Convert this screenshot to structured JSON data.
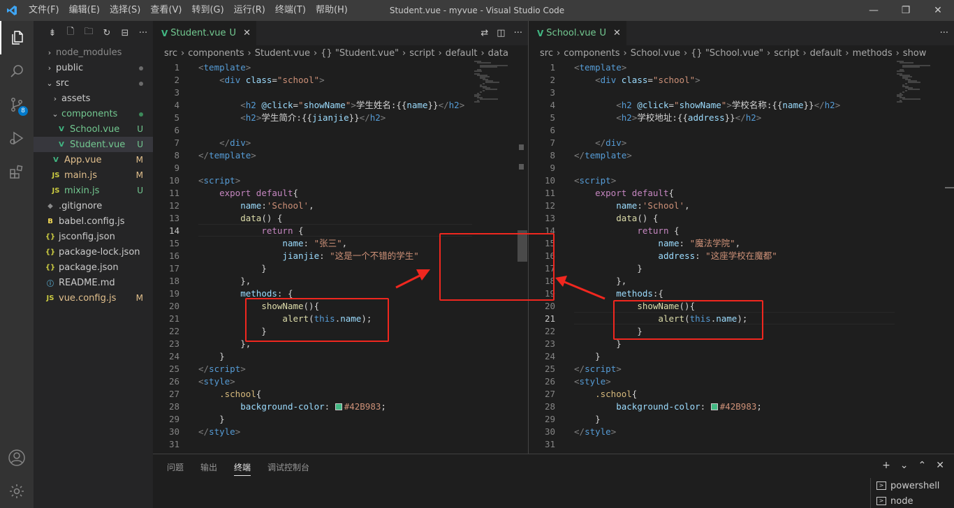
{
  "title": {
    "window_title": "Student.vue - myvue - Visual Studio Code"
  },
  "menu": [
    "文件(F)",
    "编辑(E)",
    "选择(S)",
    "查看(V)",
    "转到(G)",
    "运行(R)",
    "终端(T)",
    "帮助(H)"
  ],
  "window_controls": {
    "minimize": "—",
    "restore": "❐",
    "close": "✕"
  },
  "activity": {
    "scm_badge": "8",
    "icons": [
      "files-icon",
      "search-icon",
      "source-control-icon",
      "run-debug-icon",
      "extensions-icon",
      "account-icon",
      "settings-gear-icon"
    ]
  },
  "sidebar": {
    "toolbar_icons": [
      "collapse-all-icon",
      "new-file-icon",
      "new-folder-icon",
      "refresh-icon",
      "collapse-icon",
      "more-icon"
    ],
    "items": [
      {
        "label": "node_modules",
        "indent": 0,
        "kind": "folder",
        "open": false,
        "color": "#8c8c8c",
        "status": ""
      },
      {
        "label": "public",
        "indent": 0,
        "kind": "folder",
        "open": false,
        "color": "#cccccc",
        "status": "dot"
      },
      {
        "label": "src",
        "indent": 0,
        "kind": "folder",
        "open": true,
        "color": "#cccccc",
        "status": "dot"
      },
      {
        "label": "assets",
        "indent": 1,
        "kind": "folder",
        "open": false,
        "color": "#cccccc",
        "status": ""
      },
      {
        "label": "components",
        "indent": 1,
        "kind": "folder",
        "open": true,
        "color": "#73c991",
        "status": "dot-green"
      },
      {
        "label": "School.vue",
        "indent": 2,
        "kind": "vue",
        "color": "#73c991",
        "status": "U"
      },
      {
        "label": "Student.vue",
        "indent": 2,
        "kind": "vue",
        "color": "#73c991",
        "status": "U",
        "selected": true
      },
      {
        "label": "App.vue",
        "indent": 1,
        "kind": "vue",
        "color": "#e2c08d",
        "status": "M"
      },
      {
        "label": "main.js",
        "indent": 1,
        "kind": "js",
        "color": "#e2c08d",
        "status": "M"
      },
      {
        "label": "mixin.js",
        "indent": 1,
        "kind": "js",
        "color": "#73c991",
        "status": "U"
      },
      {
        "label": ".gitignore",
        "indent": 0,
        "kind": "git",
        "color": "#cccccc",
        "status": ""
      },
      {
        "label": "babel.config.js",
        "indent": 0,
        "kind": "babel",
        "color": "#cccccc",
        "status": ""
      },
      {
        "label": "jsconfig.json",
        "indent": 0,
        "kind": "json",
        "color": "#cccccc",
        "status": ""
      },
      {
        "label": "package-lock.json",
        "indent": 0,
        "kind": "json",
        "color": "#cccccc",
        "status": ""
      },
      {
        "label": "package.json",
        "indent": 0,
        "kind": "json",
        "color": "#cccccc",
        "status": ""
      },
      {
        "label": "README.md",
        "indent": 0,
        "kind": "info",
        "color": "#cccccc",
        "status": ""
      },
      {
        "label": "vue.config.js",
        "indent": 0,
        "kind": "js",
        "color": "#e2c08d",
        "status": "M"
      }
    ]
  },
  "editors": [
    {
      "tab": {
        "name": "Student.vue",
        "status": "U",
        "close": "✕"
      },
      "tab_actions": [
        "⇄",
        "◫",
        "···"
      ],
      "breadcrumbs": [
        "src",
        "components",
        "Student.vue",
        "{} \"Student.vue\"",
        "script",
        "default",
        "data"
      ],
      "current_line": 14,
      "lines": [
        [
          [
            "t-punc",
            "<"
          ],
          [
            "t-tag",
            "template"
          ],
          [
            "t-punc",
            ">"
          ]
        ],
        [
          [
            "t-txt",
            "    "
          ],
          [
            "t-punc",
            "<"
          ],
          [
            "t-tag",
            "div"
          ],
          [
            "t-txt",
            " "
          ],
          [
            "t-attr",
            "class"
          ],
          [
            "t-txt",
            "="
          ],
          [
            "t-str",
            "\"school\""
          ],
          [
            "t-punc",
            ">"
          ]
        ],
        [],
        [
          [
            "t-txt",
            "        "
          ],
          [
            "t-punc",
            "<"
          ],
          [
            "t-tag",
            "h2"
          ],
          [
            "t-txt",
            " "
          ],
          [
            "t-attr",
            "@click"
          ],
          [
            "t-txt",
            "="
          ],
          [
            "t-str",
            "\""
          ],
          [
            "t-attr",
            "showName"
          ],
          [
            "t-str",
            "\""
          ],
          [
            "t-punc",
            ">"
          ],
          [
            "t-txt",
            "学生姓名:{{"
          ],
          [
            "t-prop",
            "name"
          ],
          [
            "t-txt",
            "}}"
          ],
          [
            "t-punc",
            "</"
          ],
          [
            "t-tag",
            "h2"
          ],
          [
            "t-punc",
            ">"
          ]
        ],
        [
          [
            "t-txt",
            "        "
          ],
          [
            "t-punc",
            "<"
          ],
          [
            "t-tag",
            "h2"
          ],
          [
            "t-punc",
            ">"
          ],
          [
            "t-txt",
            "学生简介:{{"
          ],
          [
            "t-prop",
            "jianjie"
          ],
          [
            "t-txt",
            "}}"
          ],
          [
            "t-punc",
            "</"
          ],
          [
            "t-tag",
            "h2"
          ],
          [
            "t-punc",
            ">"
          ]
        ],
        [],
        [
          [
            "t-txt",
            "    "
          ],
          [
            "t-punc",
            "</"
          ],
          [
            "t-tag",
            "div"
          ],
          [
            "t-punc",
            ">"
          ]
        ],
        [
          [
            "t-punc",
            "</"
          ],
          [
            "t-tag",
            "template"
          ],
          [
            "t-punc",
            ">"
          ]
        ],
        [],
        [
          [
            "t-punc",
            "<"
          ],
          [
            "t-tag",
            "script"
          ],
          [
            "t-punc",
            ">"
          ]
        ],
        [
          [
            "t-txt",
            "    "
          ],
          [
            "t-kw2",
            "export"
          ],
          [
            "t-txt",
            " "
          ],
          [
            "t-kw2",
            "default"
          ],
          [
            "t-txt",
            "{"
          ]
        ],
        [
          [
            "t-txt",
            "        "
          ],
          [
            "t-prop",
            "name"
          ],
          [
            "t-txt",
            ":"
          ],
          [
            "t-str",
            "'School'"
          ],
          [
            "t-txt",
            ","
          ]
        ],
        [
          [
            "t-txt",
            "        "
          ],
          [
            "t-fn",
            "data"
          ],
          [
            "t-txt",
            "() {"
          ]
        ],
        [
          [
            "t-txt",
            "            "
          ],
          [
            "t-kw2",
            "return"
          ],
          [
            "t-txt",
            " {"
          ]
        ],
        [
          [
            "t-txt",
            "                "
          ],
          [
            "t-prop",
            "name"
          ],
          [
            "t-txt",
            ": "
          ],
          [
            "t-str",
            "\"张三\""
          ],
          [
            "t-txt",
            ","
          ]
        ],
        [
          [
            "t-txt",
            "                "
          ],
          [
            "t-prop",
            "jianjie"
          ],
          [
            "t-txt",
            ": "
          ],
          [
            "t-str",
            "\"这是一个不错的学生\""
          ]
        ],
        [
          [
            "t-txt",
            "            }"
          ]
        ],
        [
          [
            "t-txt",
            "        },"
          ]
        ],
        [
          [
            "t-txt",
            "        "
          ],
          [
            "t-prop",
            "methods"
          ],
          [
            "t-txt",
            ": {"
          ]
        ],
        [
          [
            "t-txt",
            "            "
          ],
          [
            "t-fn",
            "showName"
          ],
          [
            "t-txt",
            "(){"
          ]
        ],
        [
          [
            "t-txt",
            "                "
          ],
          [
            "t-fn",
            "alert"
          ],
          [
            "t-txt",
            "("
          ],
          [
            "t-kw",
            "this"
          ],
          [
            "t-txt",
            "."
          ],
          [
            "t-prop",
            "name"
          ],
          [
            "t-txt",
            ");"
          ]
        ],
        [
          [
            "t-txt",
            "            }"
          ]
        ],
        [
          [
            "t-txt",
            "        },"
          ]
        ],
        [
          [
            "t-txt",
            "    }"
          ]
        ],
        [
          [
            "t-punc",
            "</"
          ],
          [
            "t-tag",
            "script"
          ],
          [
            "t-punc",
            ">"
          ]
        ],
        [
          [
            "t-punc",
            "<"
          ],
          [
            "t-tag",
            "style"
          ],
          [
            "t-punc",
            ">"
          ]
        ],
        [
          [
            "t-txt",
            "    "
          ],
          [
            "t-cls",
            ".school"
          ],
          [
            "t-txt",
            "{"
          ]
        ],
        [
          [
            "t-txt",
            "        "
          ],
          [
            "t-prop",
            "background-color"
          ],
          [
            "t-txt",
            ": "
          ],
          [
            "swatch",
            ""
          ],
          [
            "t-str",
            "#42B983"
          ],
          [
            "t-txt",
            ";"
          ]
        ],
        [
          [
            "t-txt",
            "    }"
          ]
        ],
        [
          [
            "t-punc",
            "</"
          ],
          [
            "t-tag",
            "style"
          ],
          [
            "t-punc",
            ">"
          ]
        ],
        []
      ]
    },
    {
      "tab": {
        "name": "School.vue",
        "status": "U",
        "close": "✕"
      },
      "tab_actions": [
        "···"
      ],
      "breadcrumbs": [
        "src",
        "components",
        "School.vue",
        "{} \"School.vue\"",
        "script",
        "default",
        "methods",
        "show"
      ],
      "current_line": 21,
      "lines": [
        [
          [
            "t-punc",
            "<"
          ],
          [
            "t-tag",
            "template"
          ],
          [
            "t-punc",
            ">"
          ]
        ],
        [
          [
            "t-txt",
            "    "
          ],
          [
            "t-punc",
            "<"
          ],
          [
            "t-tag",
            "div"
          ],
          [
            "t-txt",
            " "
          ],
          [
            "t-attr",
            "class"
          ],
          [
            "t-txt",
            "="
          ],
          [
            "t-str",
            "\"school\""
          ],
          [
            "t-punc",
            ">"
          ]
        ],
        [],
        [
          [
            "t-txt",
            "        "
          ],
          [
            "t-punc",
            "<"
          ],
          [
            "t-tag",
            "h2"
          ],
          [
            "t-txt",
            " "
          ],
          [
            "t-attr",
            "@click"
          ],
          [
            "t-txt",
            "="
          ],
          [
            "t-str",
            "\""
          ],
          [
            "t-attr",
            "showName"
          ],
          [
            "t-str",
            "\""
          ],
          [
            "t-punc",
            ">"
          ],
          [
            "t-txt",
            "学校名称:{{"
          ],
          [
            "t-prop",
            "name"
          ],
          [
            "t-txt",
            "}}"
          ],
          [
            "t-punc",
            "</"
          ],
          [
            "t-tag",
            "h2"
          ],
          [
            "t-punc",
            ">"
          ]
        ],
        [
          [
            "t-txt",
            "        "
          ],
          [
            "t-punc",
            "<"
          ],
          [
            "t-tag",
            "h2"
          ],
          [
            "t-punc",
            ">"
          ],
          [
            "t-txt",
            "学校地址:{{"
          ],
          [
            "t-prop",
            "address"
          ],
          [
            "t-txt",
            "}}"
          ],
          [
            "t-punc",
            "</"
          ],
          [
            "t-tag",
            "h2"
          ],
          [
            "t-punc",
            ">"
          ]
        ],
        [],
        [
          [
            "t-txt",
            "    "
          ],
          [
            "t-punc",
            "</"
          ],
          [
            "t-tag",
            "div"
          ],
          [
            "t-punc",
            ">"
          ]
        ],
        [
          [
            "t-punc",
            "</"
          ],
          [
            "t-tag",
            "template"
          ],
          [
            "t-punc",
            ">"
          ]
        ],
        [],
        [
          [
            "t-punc",
            "<"
          ],
          [
            "t-tag",
            "script"
          ],
          [
            "t-punc",
            ">"
          ]
        ],
        [
          [
            "t-txt",
            "    "
          ],
          [
            "t-kw2",
            "export"
          ],
          [
            "t-txt",
            " "
          ],
          [
            "t-kw2",
            "default"
          ],
          [
            "t-txt",
            "{"
          ]
        ],
        [
          [
            "t-txt",
            "        "
          ],
          [
            "t-prop",
            "name"
          ],
          [
            "t-txt",
            ":"
          ],
          [
            "t-str",
            "'School'"
          ],
          [
            "t-txt",
            ","
          ]
        ],
        [
          [
            "t-txt",
            "        "
          ],
          [
            "t-fn",
            "data"
          ],
          [
            "t-txt",
            "() {"
          ]
        ],
        [
          [
            "t-txt",
            "            "
          ],
          [
            "t-kw2",
            "return"
          ],
          [
            "t-txt",
            " {"
          ]
        ],
        [
          [
            "t-txt",
            "                "
          ],
          [
            "t-prop",
            "name"
          ],
          [
            "t-txt",
            ": "
          ],
          [
            "t-str",
            "\"魔法学院\""
          ],
          [
            "t-txt",
            ","
          ]
        ],
        [
          [
            "t-txt",
            "                "
          ],
          [
            "t-prop",
            "address"
          ],
          [
            "t-txt",
            ": "
          ],
          [
            "t-str",
            "\"这座学校在魔都\""
          ]
        ],
        [
          [
            "t-txt",
            "            }"
          ]
        ],
        [
          [
            "t-txt",
            "        },"
          ]
        ],
        [
          [
            "t-txt",
            "        "
          ],
          [
            "t-prop",
            "methods"
          ],
          [
            "t-txt",
            ":{"
          ]
        ],
        [
          [
            "t-txt",
            "            "
          ],
          [
            "t-fn",
            "showName"
          ],
          [
            "t-txt",
            "(){"
          ]
        ],
        [
          [
            "t-txt",
            "                "
          ],
          [
            "t-fn",
            "alert"
          ],
          [
            "t-txt",
            "("
          ],
          [
            "t-kw",
            "this"
          ],
          [
            "t-txt",
            "."
          ],
          [
            "t-prop",
            "name"
          ],
          [
            "t-txt",
            ");"
          ]
        ],
        [
          [
            "t-txt",
            "            }"
          ]
        ],
        [
          [
            "t-txt",
            "        }"
          ]
        ],
        [
          [
            "t-txt",
            "    }"
          ]
        ],
        [
          [
            "t-punc",
            "</"
          ],
          [
            "t-tag",
            "script"
          ],
          [
            "t-punc",
            ">"
          ]
        ],
        [
          [
            "t-punc",
            "<"
          ],
          [
            "t-tag",
            "style"
          ],
          [
            "t-punc",
            ">"
          ]
        ],
        [
          [
            "t-txt",
            "    "
          ],
          [
            "t-cls",
            ".school"
          ],
          [
            "t-txt",
            "{"
          ]
        ],
        [
          [
            "t-txt",
            "        "
          ],
          [
            "t-prop",
            "background-color"
          ],
          [
            "t-txt",
            ": "
          ],
          [
            "swatch",
            ""
          ],
          [
            "t-str",
            "#42B983"
          ],
          [
            "t-txt",
            ";"
          ]
        ],
        [
          [
            "t-txt",
            "    }"
          ]
        ],
        [
          [
            "t-punc",
            "</"
          ],
          [
            "t-tag",
            "style"
          ],
          [
            "t-punc",
            ">"
          ]
        ],
        []
      ]
    }
  ],
  "panel": {
    "tabs": [
      "问题",
      "输出",
      "终端",
      "调试控制台"
    ],
    "active_tab": "终端",
    "actions": [
      "+",
      "⌄",
      "⌃",
      "✕"
    ],
    "terminals": [
      "powershell",
      "node"
    ]
  },
  "colors": {
    "accent": "#007acc",
    "annotation_red": "#f0271f",
    "vue_green": "#41b883"
  }
}
